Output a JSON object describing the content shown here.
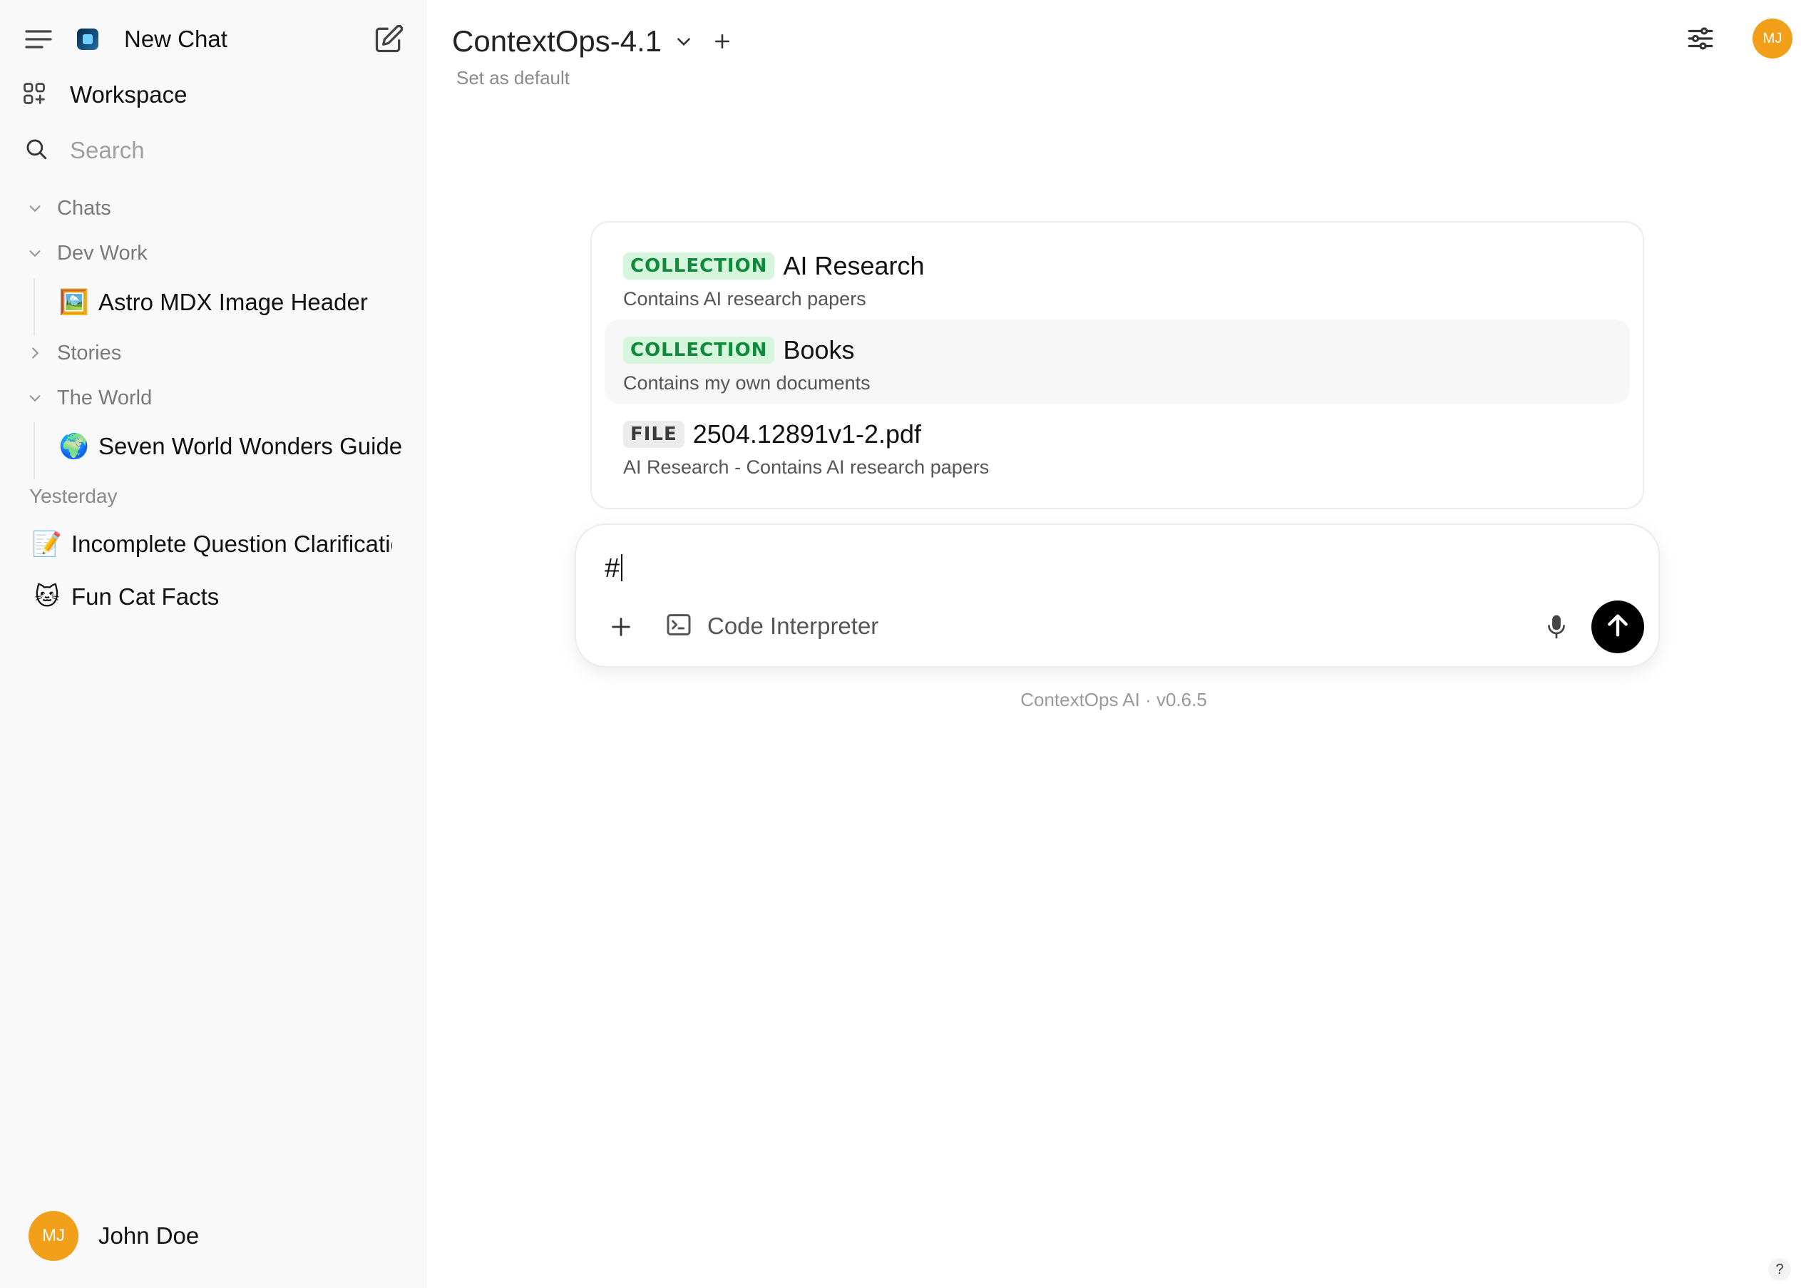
{
  "sidebar": {
    "new_chat_label": "New Chat",
    "workspace_label": "Workspace",
    "search_placeholder": "Search",
    "folders": {
      "chats": "Chats",
      "dev_work": "Dev Work",
      "stories": "Stories",
      "the_world": "The World"
    },
    "dev_work_items": [
      {
        "emoji": "🖼️",
        "title": "Astro MDX Image Header"
      }
    ],
    "the_world_items": [
      {
        "emoji": "🌍",
        "title": "Seven World Wonders Guide"
      }
    ],
    "section_yesterday": "Yesterday",
    "yesterday_items": [
      {
        "emoji": "📝",
        "title": "Incomplete Question Clarification"
      },
      {
        "emoji": "🐱",
        "title": "Fun Cat Facts"
      }
    ],
    "user": {
      "initials": "MJ",
      "name": "John Doe"
    }
  },
  "header": {
    "model_name": "ContextOps-4.1",
    "set_default_label": "Set as default",
    "avatar_initials": "MJ"
  },
  "suggestions": [
    {
      "tag": "COLLECTION",
      "title": "AI Research",
      "desc": "Contains AI research papers"
    },
    {
      "tag": "COLLECTION",
      "title": "Books",
      "desc": "Contains my own documents"
    },
    {
      "tag": "FILE",
      "title": "2504.12891v1-2.pdf",
      "desc": "AI Research - Contains AI research papers"
    }
  ],
  "composer": {
    "value": "#",
    "code_interpreter_label": "Code Interpreter"
  },
  "footer": {
    "version_text": "ContextOps AI · v0.6.5"
  },
  "help_label": "?",
  "colors": {
    "accent_avatar": "#f29f1a",
    "collection_tag_bg": "#d6f5dd",
    "collection_tag_fg": "#108a3a",
    "send_button": "#000000"
  },
  "icons": [
    "menu-icon",
    "logo-icon",
    "edit-icon",
    "workspace-icon",
    "search-icon",
    "chevron-down-icon",
    "chevron-right-icon",
    "plus-icon",
    "settings-sliders-icon",
    "terminal-icon",
    "mic-icon",
    "arrow-up-icon"
  ]
}
